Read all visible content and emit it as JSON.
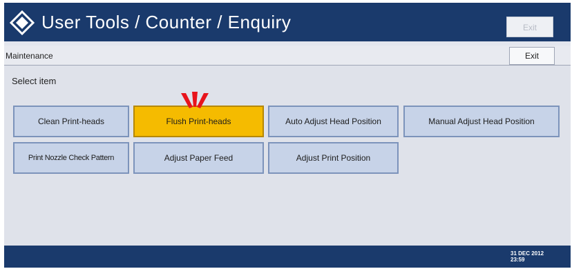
{
  "header": {
    "title": "User Tools / Counter / Enquiry",
    "exit_label": "Exit",
    "logo_icon": "diamond-logo-icon"
  },
  "maintenance": {
    "label": "Maintenance",
    "exit_label": "Exit"
  },
  "content": {
    "prompt": "Select item",
    "items": [
      {
        "label": "Clean Print-heads",
        "selected": false
      },
      {
        "label": "Flush Print-heads",
        "selected": true
      },
      {
        "label": "Auto Adjust Head Position",
        "selected": false
      },
      {
        "label": "Manual Adjust Head Position",
        "selected": false
      },
      {
        "label": "Print Nozzle Check Pattern",
        "selected": false
      },
      {
        "label": "Adjust Paper Feed",
        "selected": false
      },
      {
        "label": "Adjust Print Position",
        "selected": false
      }
    ],
    "pointer_icon": "red-pointer-icon"
  },
  "status": {
    "date": "31 DEC 2012",
    "time": "23:59"
  },
  "colors": {
    "title_bar": "#1a3a6c",
    "selected_button": "#f5bb00",
    "button": "#c7d3e8",
    "pointer": "#e8141c"
  }
}
